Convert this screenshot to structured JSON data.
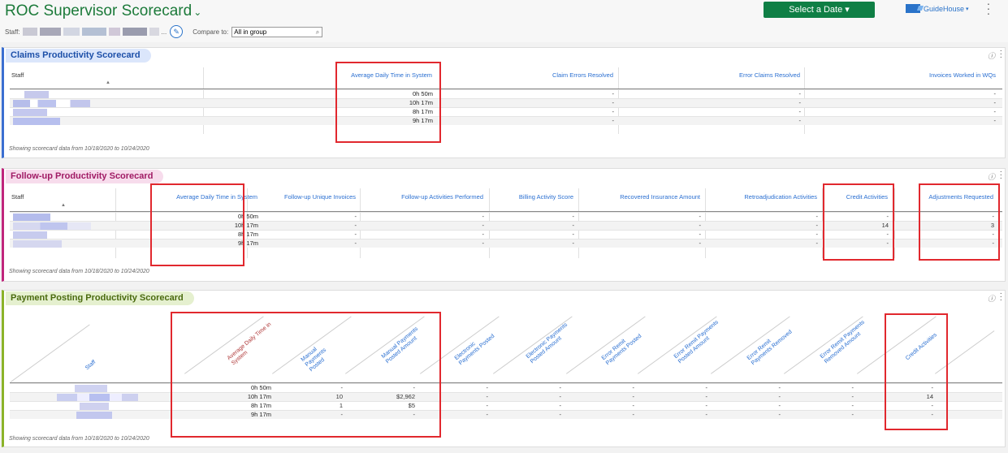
{
  "header": {
    "title": "ROC Supervisor Scorecard",
    "staff_label": "Staff:",
    "ellipsis": "...",
    "compare_label": "Compare to:",
    "compare_value": "All in group",
    "date_button": "Select a Date ▾",
    "org_name": "GuideHouse",
    "icons": [
      "chevron-down-icon",
      "pencil-icon",
      "search-icon",
      "guidehouse-logo",
      "kebab-menu-icon"
    ]
  },
  "claims": {
    "title": "Claims Productivity Scorecard",
    "columns": [
      "Staff",
      "Average Daily Time in System",
      "Claim Errors Resolved",
      "Error Claims Resolved",
      "Invoices Worked in WQs"
    ],
    "rows": [
      [
        "0h 50m",
        "-",
        "-",
        "-"
      ],
      [
        "10h 17m",
        "-",
        "-",
        "-"
      ],
      [
        "8h 17m",
        "-",
        "-",
        "-"
      ],
      [
        "9h 17m",
        "-",
        "-",
        "-"
      ]
    ],
    "footer": "Showing scorecard data from 10/18/2020 to 10/24/2020"
  },
  "followup": {
    "title": "Follow-up Productivity Scorecard",
    "columns": [
      "Staff",
      "Average Daily Time in System",
      "Follow-up Unique Invoices",
      "Follow-up Activities Performed",
      "Billing Activity Score",
      "Recovered Insurance Amount",
      "Retroadjudication Activities",
      "Credit Activities",
      "Adjustments Requested"
    ],
    "rows": [
      [
        "0h 50m",
        "-",
        "-",
        "-",
        "-",
        "-",
        "-",
        "-"
      ],
      [
        "10h 17m",
        "-",
        "-",
        "-",
        "-",
        "-",
        "14",
        "3"
      ],
      [
        "8h 17m",
        "-",
        "-",
        "-",
        "-",
        "-",
        "-",
        "-"
      ],
      [
        "9h 17m",
        "-",
        "-",
        "-",
        "-",
        "-",
        "-",
        "-"
      ]
    ],
    "footer": "Showing scorecard data from 10/18/2020 to 10/24/2020"
  },
  "payment": {
    "title": "Payment Posting Productivity Scorecard",
    "columns": [
      "Staff",
      "Average Daily Time in System",
      "Manual Payments Posted",
      "Manual Payments Posted Amount",
      "Electronic Payments Posted",
      "Electronic Payments Posted Amount",
      "Error Remit Payments Posted",
      "Error Remit Payments Posted Amount",
      "Error Remit Payments Removed",
      "Error Remit Payments Removed Amount",
      "Credit Activities"
    ],
    "rows": [
      [
        "0h 50m",
        "-",
        "-",
        "-",
        "-",
        "-",
        "-",
        "-",
        "-",
        "-"
      ],
      [
        "10h 17m",
        "10",
        "$2,962",
        "-",
        "-",
        "-",
        "-",
        "-",
        "-",
        "14"
      ],
      [
        "8h 17m",
        "1",
        "$5",
        "-",
        "-",
        "-",
        "-",
        "-",
        "-",
        "-"
      ],
      [
        "9h 17m",
        "-",
        "-",
        "-",
        "-",
        "-",
        "-",
        "-",
        "-",
        "-"
      ]
    ],
    "footer": "Showing scorecard data from 10/18/2020 to 10/24/2020"
  },
  "colors": {
    "brand_green": "#0f7f45",
    "link_blue": "#2a6fd1",
    "highlight_red": "#e1282e"
  }
}
